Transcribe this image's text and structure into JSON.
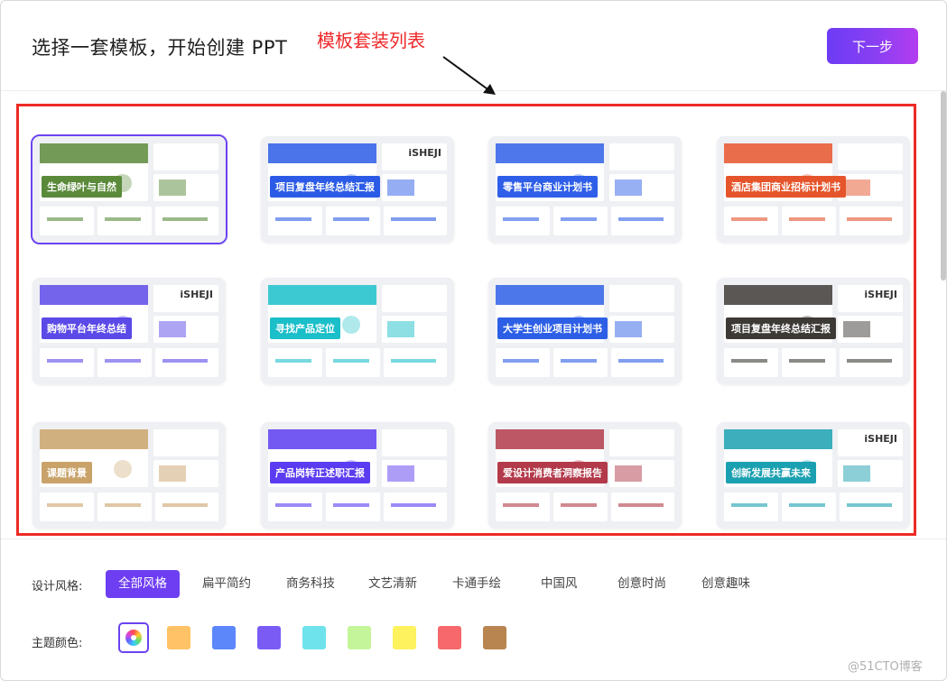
{
  "header": {
    "title": "选择一套模板，开始创建 PPT",
    "annotation": "模板套装列表",
    "next_button": "下一步"
  },
  "templates": [
    {
      "label": "生命绿叶与自然",
      "brand": "",
      "accent": "#5a8a3a"
    },
    {
      "label": "项目复盘年终总结汇报",
      "brand": "iSHEJI",
      "accent": "#2b5be6"
    },
    {
      "label": "零售平台商业计划书",
      "brand": "",
      "accent": "#2f5fe8"
    },
    {
      "label": "酒店集团商业招标计划书",
      "brand": "",
      "accent": "#e5542a"
    },
    {
      "label": "购物平台年终总结",
      "brand": "iSHEJI",
      "accent": "#5b49e8"
    },
    {
      "label": "寻找产品定位",
      "brand": "",
      "accent": "#1bbfc9"
    },
    {
      "label": "大学生创业项目计划书",
      "brand": "",
      "accent": "#2d5fe6"
    },
    {
      "label": "项目复盘年终总结汇报",
      "brand": "iSHEJI",
      "accent": "#3d3a36"
    },
    {
      "label": "课题背景",
      "brand": "",
      "accent": "#c9a26a"
    },
    {
      "label": "产品岗转正述职汇报",
      "brand": "",
      "accent": "#5b3cf0"
    },
    {
      "label": "爱设计消费者洞察报告",
      "brand": "",
      "accent": "#b23a4a"
    },
    {
      "label": "创新发展共赢未来",
      "brand": "iSHEJI",
      "accent": "#1aa0b0"
    }
  ],
  "filters": {
    "style_label": "设计风格:",
    "styles": [
      "全部风格",
      "扁平简约",
      "商务科技",
      "文艺清新",
      "卡通手绘",
      "中国风",
      "创意时尚",
      "创意趣味"
    ],
    "active_style": "全部风格",
    "color_label": "主题颜色:",
    "colors": [
      "#ffc266",
      "#5b87fa",
      "#7a5cf5",
      "#6fe3ec",
      "#c5f59a",
      "#fef25e",
      "#f6686b",
      "#b8844f"
    ]
  },
  "watermark": "@51CTO博客"
}
